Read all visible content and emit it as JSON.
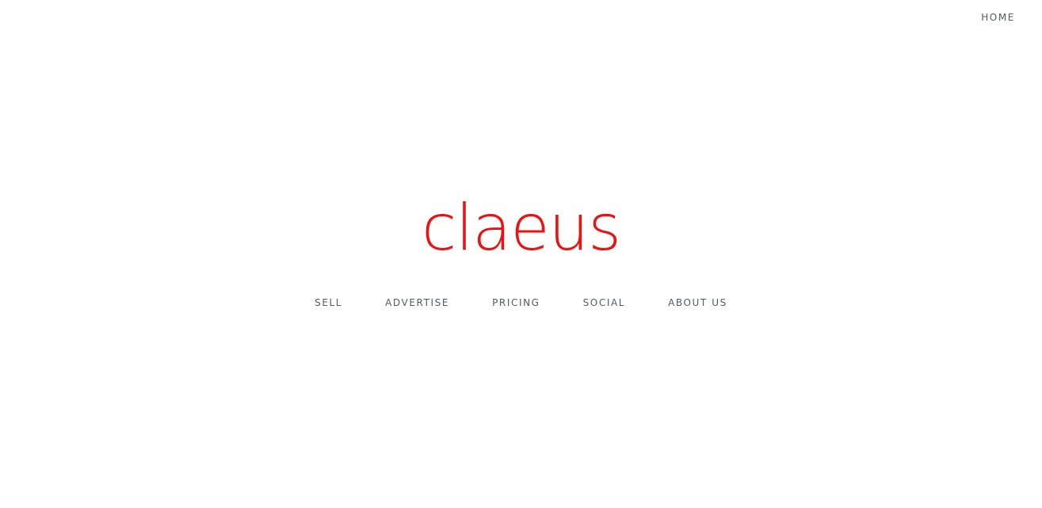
{
  "header": {
    "home_label": "HOME"
  },
  "brand": {
    "name": "claeus",
    "color": "#ee1111"
  },
  "nav": {
    "items": [
      {
        "label": "SELL"
      },
      {
        "label": "ADVERTISE"
      },
      {
        "label": "PRICING"
      },
      {
        "label": "SOCIAL"
      },
      {
        "label": "ABOUT US"
      }
    ]
  }
}
